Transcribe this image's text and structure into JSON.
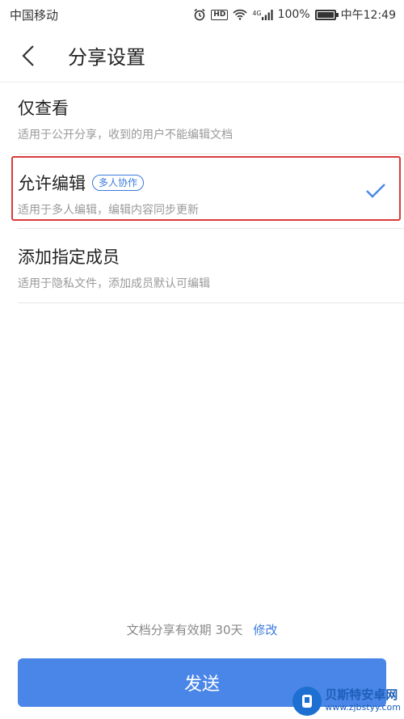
{
  "status_bar": {
    "carrier": "中国移动",
    "network": "4G",
    "battery": "100%",
    "battery_level": 1.0,
    "time": "中午12:49",
    "hd_label": "HD"
  },
  "header": {
    "back_icon": "chevron-left-icon",
    "title": "分享设置"
  },
  "options": [
    {
      "title": "仅查看",
      "description": "适用于公开分享，收到的用户不能编辑文档",
      "selected": false
    },
    {
      "title": "允许编辑",
      "tag": "多人协作",
      "description": "适用于多人编辑，编辑内容同步更新",
      "selected": true
    },
    {
      "title": "添加指定成员",
      "description": "适用于隐私文件，添加成员默认可编辑",
      "selected": false
    }
  ],
  "footer": {
    "expiry_text": "文档分享有效期 30天",
    "edit_link": "修改",
    "send_label": "发送"
  },
  "watermark": {
    "title": "贝斯特安卓网",
    "url": "www.zjbstyy.com"
  },
  "colors": {
    "accent": "#4a86e8",
    "link": "#3b7bdc",
    "highlight_frame": "#d93a3a"
  }
}
